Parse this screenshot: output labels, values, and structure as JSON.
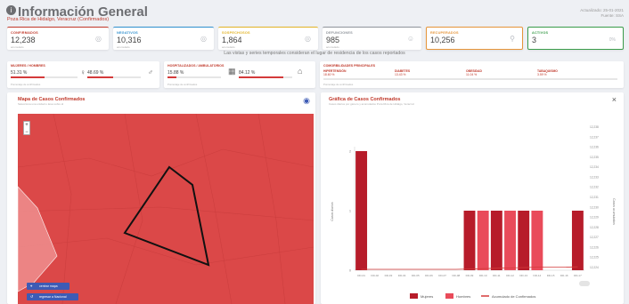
{
  "header": {
    "title": "Información General",
    "subtitle": "Poza Rica de Hidalgo, Veracruz (Confirmados)",
    "updated_line1": "Actualizado: 25-01-2021",
    "updated_line2": "Fuente: SSA"
  },
  "cards": [
    {
      "label": "CONFIRMADOS",
      "value": "12,238",
      "sub": "acumulado",
      "color": "#c0392b",
      "icon": "people-icon"
    },
    {
      "label": "NEGATIVOS",
      "value": "10,316",
      "sub": "acumulado",
      "color": "#2f8fce",
      "icon": "people-icon"
    },
    {
      "label": "SOSPECHOSOS",
      "value": "1,864",
      "sub": "acumulado",
      "color": "#e2b325",
      "icon": "people-icon"
    },
    {
      "label": "DEFUNCIONES",
      "value": "985",
      "sub": "acumulado",
      "color": "#8f949b",
      "icon": "person-icon"
    },
    {
      "label": "RECUPERADOS",
      "value": "10,256",
      "sub": "",
      "color": "#e6953a",
      "icon": "walking-icon"
    },
    {
      "label": "ACTIVOS",
      "value": "3",
      "sub": "",
      "color": "#3a9c4a",
      "icon": "percent-icon",
      "extra": "0%"
    }
  ],
  "notice": "Las vistas y series temporales consideran el lugar de residencia de los casos reportados",
  "gender_panel": {
    "label": "MUJERES / HOMBRES",
    "women_pct": "51.31 %",
    "men_pct": "48.69 %",
    "women_frac": 0.513,
    "men_frac": 0.487,
    "note": "Porcentaje de confirmados"
  },
  "hospital_panel": {
    "label": "HOSPITALIZADOS / AMBULATORIOS",
    "hosp_pct": "15.88 %",
    "amb_pct": "84.12 %",
    "hosp_frac": 0.159,
    "amb_frac": 0.841,
    "note": "Porcentaje de confirmados"
  },
  "comorb_panel": {
    "label": "COMORBILIDADES PRINCIPALES",
    "items": [
      {
        "name": "HIPERTENSIÓN",
        "pct": "18.60 %",
        "frac": 0.186
      },
      {
        "name": "DIABETES",
        "pct": "13.43 %",
        "frac": 0.134
      },
      {
        "name": "OBESIDAD",
        "pct": "11.04 %",
        "frac": 0.11
      },
      {
        "name": "TABAQUISMO",
        "pct": "3.59 %",
        "frac": 0.036
      }
    ],
    "note": "Porcentaje de confirmados"
  },
  "map_panel": {
    "title": "Mapa de Casos Confirmados",
    "subtitle": "Selecciona una unidad o área sobre él",
    "btn_center": "centrar mapa",
    "btn_back": "regresar a Nacional",
    "zoom_in": "+",
    "zoom_out": "−"
  },
  "chart_panel": {
    "title": "Gráfica de Casos Confirmados",
    "subtitle": "Casos diarios por género y acumulados Poza Rica de Hidalgo, Veracruz",
    "close": "×",
    "ylabel": "Casos diarios",
    "y2label": "Casos acumulados",
    "toggle": ""
  },
  "chart_data": {
    "type": "bar",
    "categories": [
      "DD-01",
      "DD-02",
      "DD-03",
      "DD-04",
      "DD-05",
      "DD-06",
      "DD-07",
      "DD-08",
      "DD-09",
      "DD-10",
      "DD-11",
      "DD-12",
      "DD-13",
      "DD-14",
      "DD-15",
      "DD-16",
      "DD-17"
    ],
    "series": [
      {
        "name": "Mujeres",
        "color": "#b71c2a",
        "values": [
          2,
          0,
          0,
          0,
          0,
          0,
          0,
          0,
          1,
          0,
          1,
          0,
          1,
          0,
          0,
          0,
          1
        ]
      },
      {
        "name": "Hombres",
        "color": "#e94b5a",
        "values": [
          0,
          0,
          0,
          0,
          0,
          0,
          0,
          0,
          0,
          1,
          0,
          1,
          0,
          1,
          0,
          0,
          0
        ]
      },
      {
        "name": "Acumulado de Confirmados",
        "color": "#d43a3a",
        "type": "line",
        "values": [
          12224,
          12224,
          12224,
          12224,
          12224,
          12224,
          12224,
          12224,
          12225,
          12226,
          12227,
          12228,
          12229,
          12230,
          12230,
          12230,
          12231
        ]
      }
    ],
    "yticks_left": [
      0,
      1,
      2
    ],
    "yticks_right": [
      "12,224",
      "12,225",
      "12,226",
      "12,227",
      "12,228",
      "12,229",
      "12,230",
      "12,231",
      "12,232",
      "12,233",
      "12,234",
      "12,235",
      "12,236",
      "12,237",
      "12,238"
    ],
    "ylabel": "Casos diarios",
    "y2label": "Casos acumulados",
    "legend_position": "bottom"
  }
}
